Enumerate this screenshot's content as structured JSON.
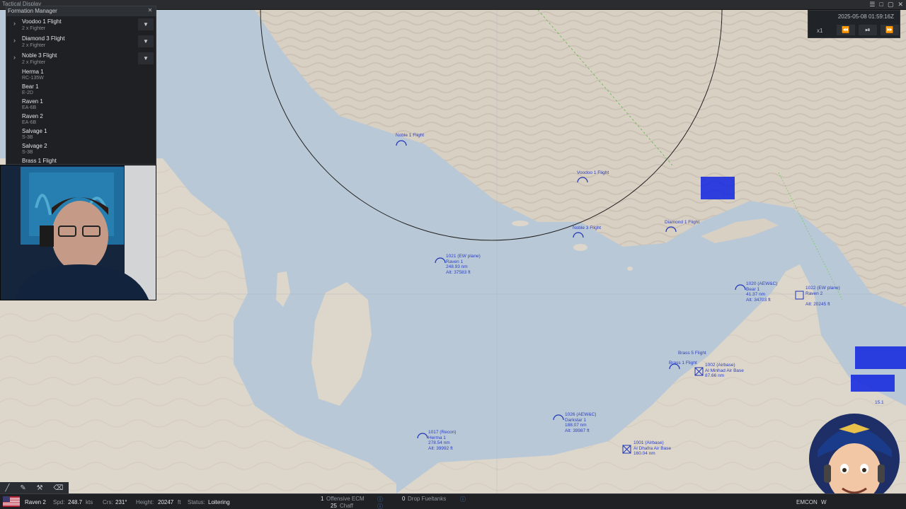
{
  "window": {
    "title": "Tactical Display",
    "controls": [
      "☰",
      "□",
      "▢",
      "✕"
    ]
  },
  "formation_manager": {
    "title": "Formation Manager",
    "close_glyph": "✕",
    "groups": [
      {
        "name": "Voodoo 1 Flight",
        "sub": "2 x Fighter"
      },
      {
        "name": "Diamond 3 Flight",
        "sub": "2 x Fighter"
      },
      {
        "name": "Noble 3 Flight",
        "sub": "2 x Fighter"
      }
    ],
    "singles": [
      {
        "name": "Herma 1",
        "sub": "RC-135W"
      },
      {
        "name": "Bear 1",
        "sub": "E-2D"
      },
      {
        "name": "Raven 1",
        "sub": "EA-6B"
      },
      {
        "name": "Raven 2",
        "sub": "EA-6B"
      },
      {
        "name": "Salvage 1",
        "sub": "S-3B"
      },
      {
        "name": "Salvage 2",
        "sub": "S-3B"
      }
    ],
    "partial_group": "Brass 1 Flight"
  },
  "time_control": {
    "datetime": "2025-05-08 01:59:16Z",
    "speed": "x1",
    "rewind": "⏪",
    "play_pause": "⏯",
    "fast_forward": "⏩"
  },
  "map_labels": {
    "noble1": "Noble 1 Flight",
    "voodoo1": "Voodoo 1 Flight",
    "diamond1": "Diamond 1 Flight",
    "noble3": "Noble 3 Flight",
    "raven1": [
      "1021 (EW plane)",
      "Raven 1",
      "248.93 nm",
      "Alt: 37583 ft"
    ],
    "bear1": [
      "1020 (AEW&C)",
      "Bear 1",
      "41.37 nm",
      "Alt: 34703 ft"
    ],
    "raven2": [
      "1022 (EW plane)",
      "Raven 2",
      "",
      "Alt: 20245 ft"
    ],
    "brass5": "Brass 5 Flight",
    "brass1": "Brass 1 Flight",
    "minhad": [
      "1002 (Airbase)",
      "Al Minhad Air Base",
      "87.66 nm"
    ],
    "darkstar": [
      "1026 (AEW&C)",
      "Darkstar 1",
      "188.07 nm",
      "Alt: 39987 ft"
    ],
    "herma": [
      "1017 (Recon)",
      "Herma 1",
      "278.54 nm",
      "Alt: 39992 ft"
    ],
    "dhafra": [
      "1001 (Airbase)",
      "Al Dhafra Air Base",
      "160.04 nm"
    ],
    "misc": "15.1"
  },
  "status_bar": {
    "unit": "Raven 2",
    "spd_label": "Spd:",
    "spd_value": "248.7",
    "spd_unit": "kts",
    "crs_label": "Crs:",
    "crs_value": "231°",
    "height_label": "Height:",
    "height_value": "20247",
    "height_unit": "ft",
    "status_label": "Status:",
    "status_value": "Loitering",
    "ecm_count": "1",
    "ecm_label": "Offensive ECM",
    "chaff_count": "25",
    "chaff_label": "Chaff",
    "tanks_count": "0",
    "tanks_label": "Drop Fueltanks",
    "emcon": "EMCON",
    "weapons_partial": "W"
  },
  "colors": {
    "unit_blue": "#1f35b8",
    "sea": "#b8c7d6",
    "land": "#d8d0c4"
  }
}
